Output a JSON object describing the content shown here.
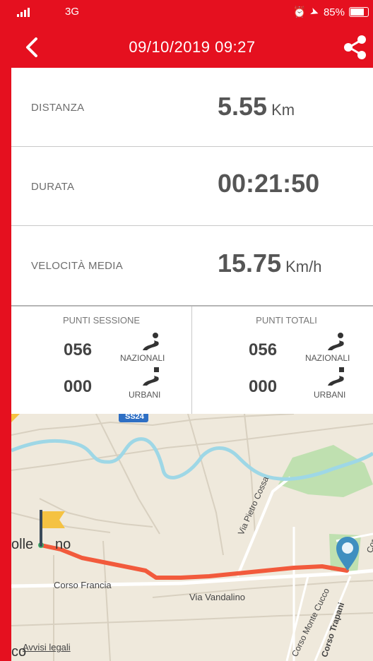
{
  "status_bar": {
    "network": "3G",
    "battery": "85%"
  },
  "header": {
    "title": "09/10/2019 09:27"
  },
  "stats": [
    {
      "label": "DISTANZA",
      "value": "5.55",
      "unit": "Km"
    },
    {
      "label": "DURATA",
      "value": "00:21:50",
      "unit": ""
    },
    {
      "label": "VELOCITÀ MEDIA",
      "value": "15.75",
      "unit": "Km/h"
    }
  ],
  "points": {
    "session": {
      "title": "PUNTI SESSIONE",
      "nazionali": "056",
      "nazionali_label": "NAZIONALI",
      "urbani": "000",
      "urbani_label": "URBANI"
    },
    "total": {
      "title": "PUNTI TOTALI",
      "nazionali": "056",
      "nazionali_label": "NAZIONALI",
      "urbani": "000",
      "urbani_label": "URBANI"
    }
  },
  "map": {
    "road_badge": "SS24",
    "place_partial": "olle",
    "place_partial2": "no",
    "streets": [
      "Via Pietro Cossa",
      "Corso Francia",
      "Via Vandalino",
      "Corso Monte Cucco",
      "Corso Trapani",
      "Cor"
    ],
    "legal": "Avvisi legali",
    "bottom_left": "co",
    "route_color": "#f25a3c",
    "start_flag_color": "#f5c242",
    "end_pin_color": "#3f8fc0"
  },
  "colors": {
    "brand": "#e5101f"
  }
}
